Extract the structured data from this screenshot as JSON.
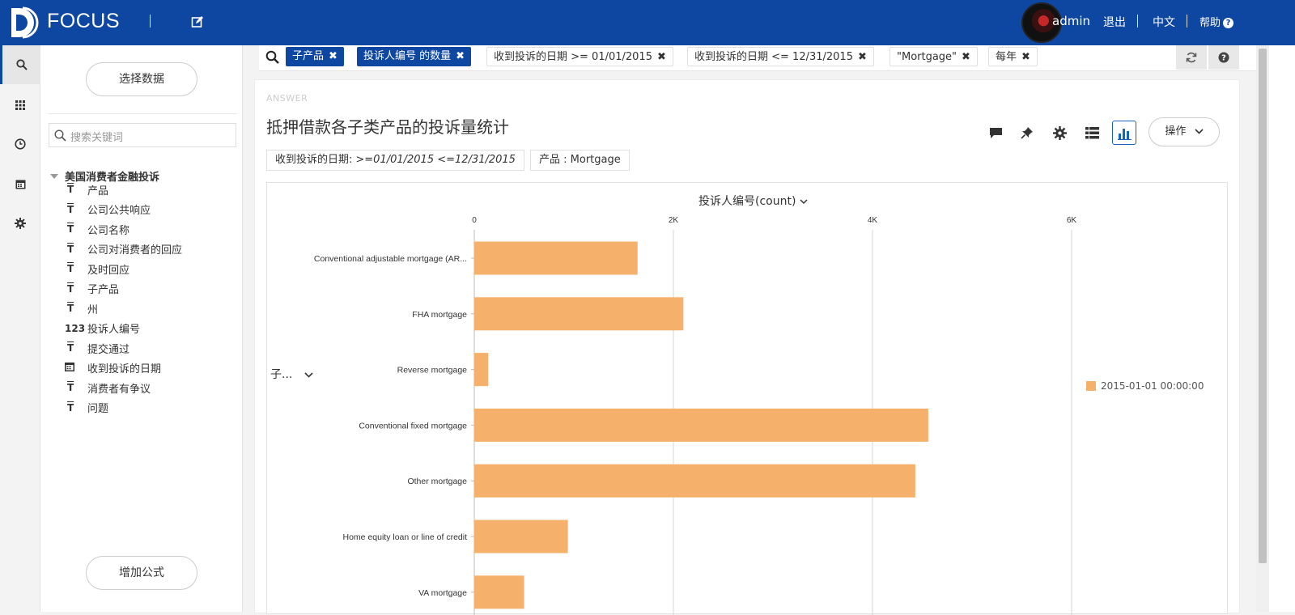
{
  "header": {
    "brand": "FOCUS",
    "user": "admin",
    "logout": "退出",
    "language": "中文",
    "help": "帮助"
  },
  "sidebar": {
    "select_data": "选择数据",
    "search_placeholder": "搜索关键词",
    "source_name": "美国消费者金融投诉",
    "fields": [
      {
        "icon": "text",
        "label": "产品"
      },
      {
        "icon": "text",
        "label": "公司公共响应"
      },
      {
        "icon": "text",
        "label": "公司名称"
      },
      {
        "icon": "text",
        "label": "公司对消费者的回应"
      },
      {
        "icon": "text",
        "label": "及时回应"
      },
      {
        "icon": "text",
        "label": "子产品"
      },
      {
        "icon": "text",
        "label": "州"
      },
      {
        "icon": "number",
        "label": "投诉人编号"
      },
      {
        "icon": "text",
        "label": "提交通过"
      },
      {
        "icon": "date",
        "label": "收到投诉的日期"
      },
      {
        "icon": "text",
        "label": "消费者有争议"
      },
      {
        "icon": "text",
        "label": "问题"
      }
    ],
    "add_formula": "增加公式"
  },
  "search_chips": [
    {
      "label": "子产品",
      "style": "blue"
    },
    {
      "label": "投诉人编号 的数量",
      "style": "blue"
    },
    {
      "label": "收到投诉的日期 >= 01/01/2015",
      "style": "grey"
    },
    {
      "label": "收到投诉的日期 <= 12/31/2015",
      "style": "grey"
    },
    {
      "label": "\"Mortgage\"",
      "style": "grey"
    },
    {
      "label": "每年",
      "style": "grey"
    }
  ],
  "answer": {
    "label": "ANSWER",
    "title": "抵押借款各子类产品的投诉量统计",
    "ops_button": "操作",
    "filters": [
      {
        "label": "收到投诉的日期:",
        "value": ">=01/01/2015   <=12/31/2015"
      },
      {
        "label": "产品 : Mortgage",
        "value": ""
      }
    ]
  },
  "chart_data": {
    "type": "bar",
    "orientation": "horizontal",
    "xlabel": "投诉人编号(count)",
    "ylabel": "子...",
    "xlim": [
      0,
      7000
    ],
    "xticks": [
      0,
      2000,
      4000,
      6000
    ],
    "xtick_labels": [
      "0",
      "2K",
      "4K",
      "6K"
    ],
    "categories": [
      "Conventional adjustable mortgage (AR...",
      "FHA mortgage",
      "Reverse mortgage",
      "Conventional fixed mortgage",
      "Other mortgage",
      "Home equity loan or line of credit",
      "VA mortgage"
    ],
    "series": [
      {
        "name": "2015-01-01 00:00:00",
        "color": "#f5b06c",
        "values": [
          1640,
          2100,
          140,
          4560,
          4430,
          940,
          500
        ]
      }
    ],
    "grid": true,
    "legend_position": "right"
  }
}
